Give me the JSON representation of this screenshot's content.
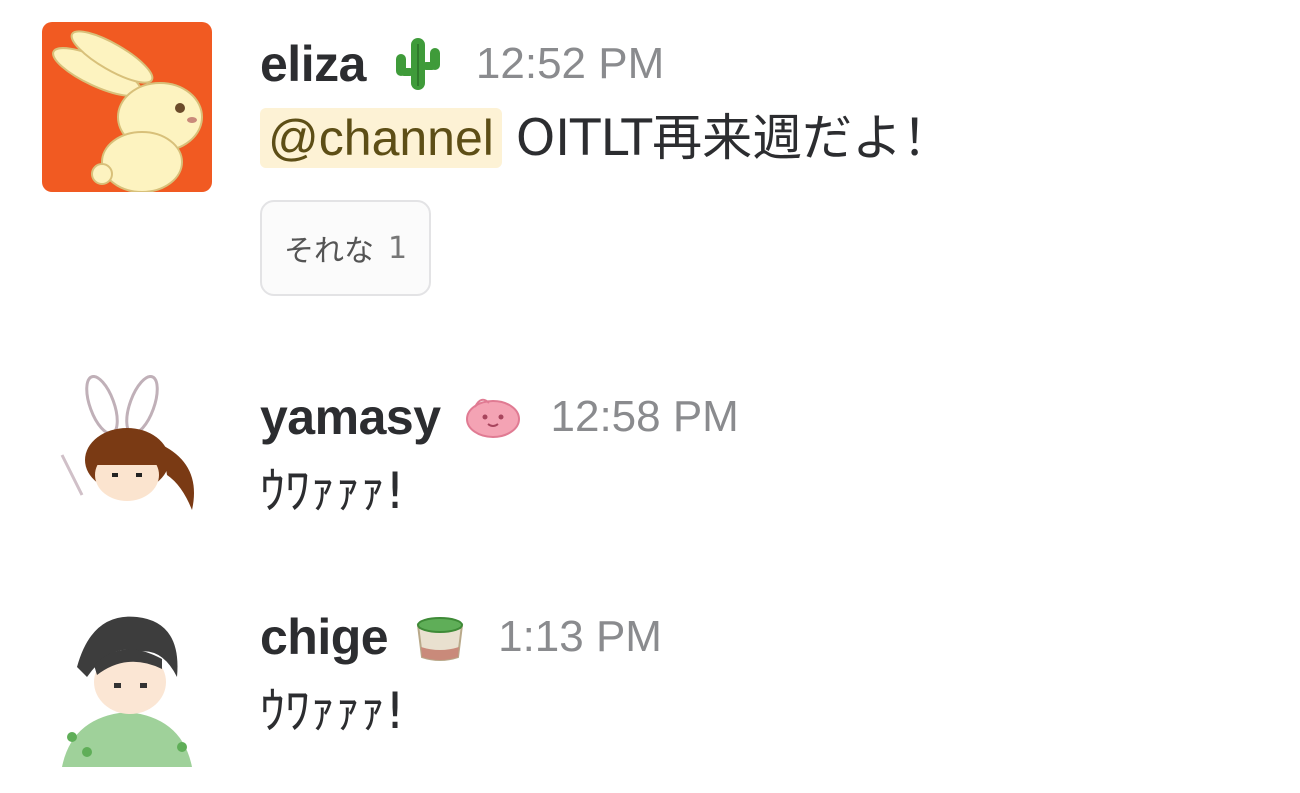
{
  "messages": [
    {
      "username": "eliza",
      "status_emoji": "cactus-icon",
      "timestamp": "12:52 PM",
      "mention": "@channel",
      "text": "OITLT再来週だよ！",
      "reaction": {
        "label": "それな",
        "count": "1"
      }
    },
    {
      "username": "yamasy",
      "status_emoji": "pink-blob-icon",
      "timestamp": "12:58 PM",
      "text": "ｳﾜｧｧｧ!"
    },
    {
      "username": "chige",
      "status_emoji": "matcha-tea-icon",
      "timestamp": "1:13 PM",
      "text": "ｳﾜｧｧｧ!"
    }
  ],
  "colors": {
    "mention_bg": "#fdf2d5",
    "mention_text": "#5d4e16",
    "timestamp": "#8a8b8e",
    "avatar1_bg": "#f15a22"
  }
}
